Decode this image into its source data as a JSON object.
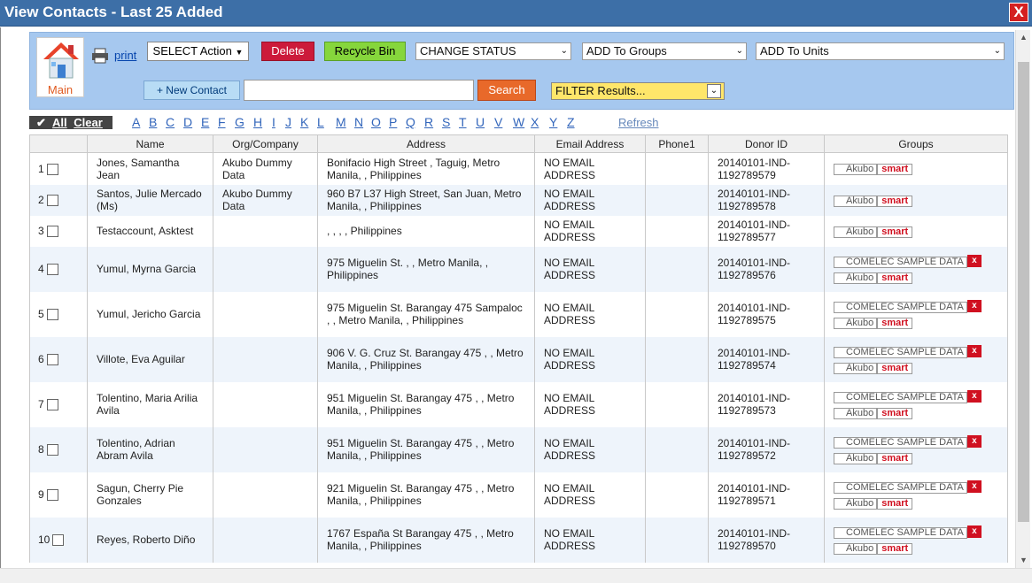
{
  "window": {
    "title": "View Contacts - Last 25 Added",
    "close_label": "X"
  },
  "toolbar": {
    "main_label": "Main",
    "print_label": "print",
    "select_action": "SELECT Action",
    "delete": "Delete",
    "recycle_bin": "Recycle Bin",
    "change_status": "CHANGE STATUS",
    "add_to_groups": "ADD To Groups",
    "add_to_units": "ADD To Units",
    "new_contact": "+  New Contact",
    "search_button": "Search",
    "search_value": "",
    "filter": "FILTER Results..."
  },
  "alpha": {
    "all": "All",
    "clear": "Clear",
    "letters": [
      "A",
      "B",
      "C",
      "D",
      "E",
      "F",
      "G",
      "H",
      "I",
      "J",
      "K",
      "L",
      "M",
      "N",
      "O",
      "P",
      "Q",
      "R",
      "S",
      "T",
      "U",
      "V",
      "W",
      "X",
      "Y",
      "Z"
    ],
    "refresh": "Refresh"
  },
  "table": {
    "columns": [
      "",
      "Name",
      "Org/Company",
      "Address",
      "Email Address",
      "Phone1",
      "Donor ID",
      "Groups"
    ],
    "rows": [
      {
        "num": "1",
        "name": "Jones, Samantha Jean",
        "org": "Akubo Dummy Data",
        "address": "Bonifacio High Street , Taguig, Metro Manila, , Philippines",
        "email": "NO EMAIL ADDRESS",
        "phone": "",
        "donor": "20140101-IND-1192789579",
        "comelec": "",
        "akubo": "Akubo",
        "smart": "smart"
      },
      {
        "num": "2",
        "name": "Santos, Julie Mercado (Ms)",
        "org": "Akubo Dummy Data",
        "address": "960 B7 L37 High Street, San Juan, Metro Manila, , Philippines",
        "email": "NO EMAIL ADDRESS",
        "phone": "",
        "donor": "20140101-IND-1192789578",
        "comelec": "",
        "akubo": "Akubo",
        "smart": "smart"
      },
      {
        "num": "3",
        "name": "Testaccount, Asktest",
        "org": "",
        "address": ", , , , Philippines",
        "email": "NO EMAIL ADDRESS",
        "phone": "",
        "donor": "20140101-IND-1192789577",
        "comelec": "",
        "akubo": "Akubo",
        "smart": "smart"
      },
      {
        "num": "4",
        "name": "Yumul, Myrna Garcia",
        "org": "",
        "address": "975 Miguelin St. , , Metro Manila, , Philippines",
        "email": "NO EMAIL ADDRESS",
        "phone": "",
        "donor": "20140101-IND-1192789576",
        "comelec": "COMELEC SAMPLE DATA",
        "akubo": "Akubo",
        "smart": "smart"
      },
      {
        "num": "5",
        "name": "Yumul, Jericho Garcia",
        "org": "",
        "address": "975 Miguelin St. Barangay 475 Sampaloc , , Metro Manila, , Philippines",
        "email": "NO EMAIL ADDRESS",
        "phone": "",
        "donor": "20140101-IND-1192789575",
        "comelec": "COMELEC SAMPLE DATA",
        "akubo": "Akubo",
        "smart": "smart"
      },
      {
        "num": "6",
        "name": "Villote, Eva Aguilar",
        "org": "",
        "address": "906 V. G. Cruz St. Barangay 475 , , Metro Manila, , Philippines",
        "email": "NO EMAIL ADDRESS",
        "phone": "",
        "donor": "20140101-IND-1192789574",
        "comelec": "COMELEC SAMPLE DATA",
        "akubo": "Akubo",
        "smart": "smart"
      },
      {
        "num": "7",
        "name": "Tolentino, Maria Arilia Avila",
        "org": "",
        "address": "951 Miguelin St. Barangay 475 , , Metro Manila, , Philippines",
        "email": "NO EMAIL ADDRESS",
        "phone": "",
        "donor": "20140101-IND-1192789573",
        "comelec": "COMELEC SAMPLE DATA",
        "akubo": "Akubo",
        "smart": "smart"
      },
      {
        "num": "8",
        "name": "Tolentino, Adrian Abram Avila",
        "org": "",
        "address": "951 Miguelin St. Barangay 475 , , Metro Manila, , Philippines",
        "email": "NO EMAIL ADDRESS",
        "phone": "",
        "donor": "20140101-IND-1192789572",
        "comelec": "COMELEC SAMPLE DATA",
        "akubo": "Akubo",
        "smart": "smart"
      },
      {
        "num": "9",
        "name": "Sagun, Cherry Pie Gonzales",
        "org": "",
        "address": "921 Miguelin St. Barangay 475 , , Metro Manila, , Philippines",
        "email": "NO EMAIL ADDRESS",
        "phone": "",
        "donor": "20140101-IND-1192789571",
        "comelec": "COMELEC SAMPLE DATA",
        "akubo": "Akubo",
        "smart": "smart"
      },
      {
        "num": "10",
        "name": "Reyes, Roberto Diño",
        "org": "",
        "address": "1767 España St Barangay 475 , , Metro Manila, , Philippines",
        "email": "NO EMAIL ADDRESS",
        "phone": "",
        "donor": "20140101-IND-1192789570",
        "comelec": "COMELEC SAMPLE DATA",
        "akubo": "Akubo",
        "smart": "smart"
      }
    ]
  },
  "colors": {
    "titlebar": "#3d6fa7",
    "toolbar": "#a6c8ef",
    "delete": "#cc1a3a",
    "recycle": "#86d63c",
    "search": "#e8692a",
    "filter": "#ffe66a",
    "close": "#d42020"
  }
}
